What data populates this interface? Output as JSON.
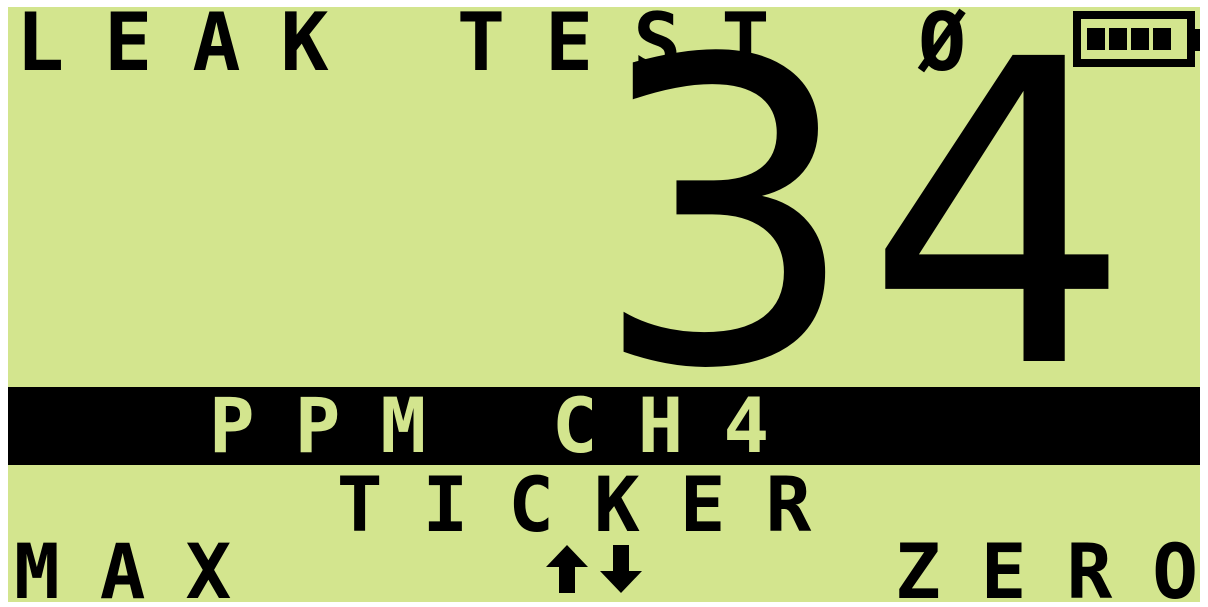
{
  "header": {
    "title": "LEAK TEST",
    "zero_indicator": "Ø",
    "battery_icon": "battery-full-icon"
  },
  "reading": {
    "value": "34",
    "unit": "PPM CH4",
    "mode": "TICKER"
  },
  "softkeys": {
    "left_label": "MAX",
    "center_icon": "up-down-arrows-icon",
    "right_label": "ZERO"
  },
  "colors": {
    "lcd_background": "#d3e58e",
    "pixel": "#000000"
  }
}
